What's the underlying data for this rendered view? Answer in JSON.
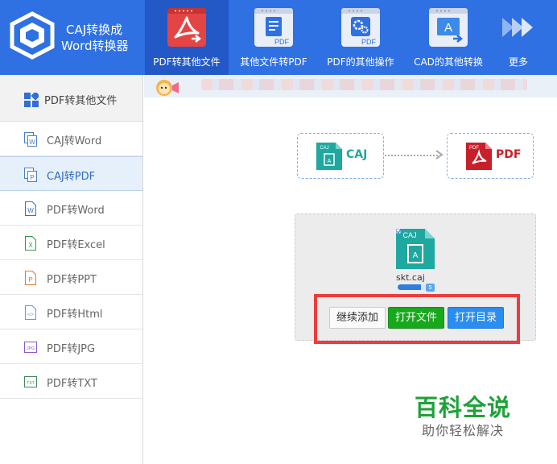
{
  "app": {
    "title_line1": "CAJ转换成",
    "title_line2": "Word转换器"
  },
  "nav": [
    {
      "label": "PDF转其他文件",
      "icon": "pdf-acrobat-icon",
      "icon_text": "",
      "active": true
    },
    {
      "label": "其他文件转PDF",
      "icon": "document-to-pdf-icon",
      "icon_text": "PDF"
    },
    {
      "label": "PDF的其他操作",
      "icon": "pdf-settings-icon",
      "icon_text": "PDF"
    },
    {
      "label": "CAD的其他转换",
      "icon": "cad-convert-icon",
      "icon_text": "A"
    },
    {
      "label": "更多",
      "icon": "more-arrows-icon",
      "icon_text": ""
    }
  ],
  "sidebar": {
    "header": "PDF转其他文件",
    "items": [
      {
        "label": "CAJ转Word",
        "icon": "caj-word-icon",
        "glyph": "W",
        "color": "#4a7fc9"
      },
      {
        "label": "CAJ转PDF",
        "icon": "caj-pdf-icon",
        "glyph": "P",
        "color": "#4a7fc9",
        "active": true
      },
      {
        "label": "PDF转Word",
        "icon": "word-file-icon",
        "glyph": "W",
        "color": "#3b6fc2"
      },
      {
        "label": "PDF转Excel",
        "icon": "excel-file-icon",
        "glyph": "X",
        "color": "#2e9a4a"
      },
      {
        "label": "PDF转PPT",
        "icon": "ppt-file-icon",
        "glyph": "P",
        "color": "#e07a2c"
      },
      {
        "label": "PDF转Html",
        "icon": "html-file-icon",
        "glyph": "</>",
        "color": "#5c9ad8"
      },
      {
        "label": "PDF转JPG",
        "icon": "jpg-file-icon",
        "glyph": "JPG",
        "color": "#8a5cc6"
      },
      {
        "label": "PDF转TXT",
        "icon": "txt-file-icon",
        "glyph": "TXT",
        "color": "#3e8a5a"
      }
    ]
  },
  "conversion": {
    "from_tag": "CAJ",
    "from_label": "CAJ",
    "to_tag": "PDF",
    "to_label": "PDF"
  },
  "file": {
    "tag": "CAJ",
    "name": "skt.caj",
    "badge": "5",
    "progress": 0.8
  },
  "buttons": {
    "add": "继续添加",
    "open_file": "打开文件",
    "open_dir": "打开目录"
  },
  "watermark": {
    "title": "百科全说",
    "subtitle": "助你轻松解决"
  },
  "colors": {
    "header": "#2f70e3",
    "accent_green": "#18a81c",
    "accent_blue": "#2a8ef0",
    "highlight_red": "#ee3b3b",
    "caj_teal": "#1fa8a0",
    "pdf_red": "#c8202a"
  }
}
